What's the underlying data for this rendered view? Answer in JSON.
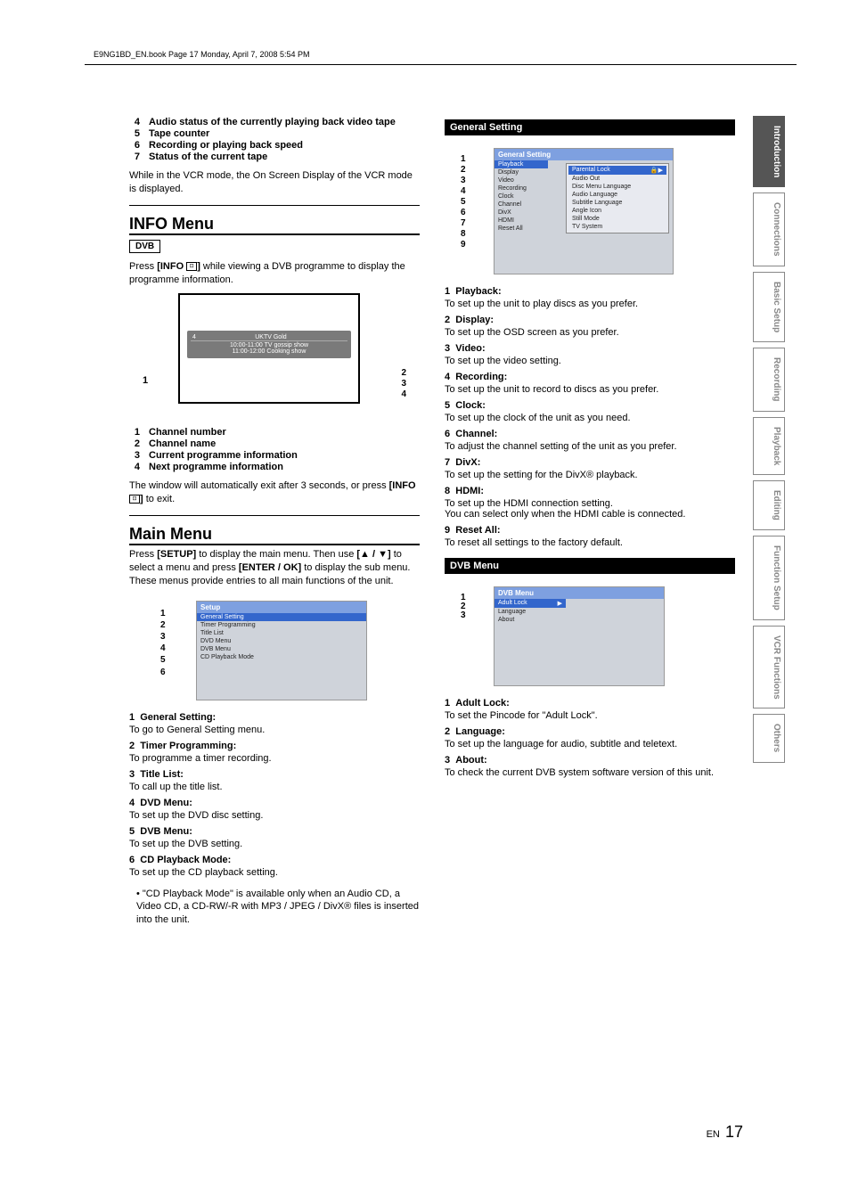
{
  "header": "E9NG1BD_EN.book  Page 17  Monday, April 7, 2008  5:54 PM",
  "side_tabs": [
    "Introduction",
    "Connections",
    "Basic Setup",
    "Recording",
    "Playback",
    "Editing",
    "Function Setup",
    "VCR Functions",
    "Others"
  ],
  "left": {
    "audio_items": [
      {
        "n": "4",
        "t": "Audio status of the currently playing back video tape"
      },
      {
        "n": "5",
        "t": "Tape counter"
      },
      {
        "n": "6",
        "t": "Recording or playing back speed"
      },
      {
        "n": "7",
        "t": "Status of the current tape"
      }
    ],
    "audio_note": "While in the VCR mode, the On Screen Display of the VCR mode is displayed.",
    "info_heading": "INFO Menu",
    "dvb_badge": "DVB",
    "info_text_a": "Press ",
    "info_text_b": "[INFO ",
    "info_text_c": "]",
    "info_text_d": " while viewing a DVB programme to display the programme information.",
    "tv": {
      "ch_num": "4",
      "ch_name": "UKTV Gold",
      "line1": "10:00-11:00 TV gossip show",
      "line2": "11:00-12:00 Cooking show"
    },
    "info_callouts_left": [
      "1"
    ],
    "info_callouts_right": [
      "2",
      "3",
      "4"
    ],
    "info_items": [
      {
        "n": "1",
        "t": "Channel number"
      },
      {
        "n": "2",
        "t": "Channel name"
      },
      {
        "n": "3",
        "t": "Current programme information"
      },
      {
        "n": "4",
        "t": "Next programme information"
      }
    ],
    "info_note_a": "The window will automatically exit after 3 seconds, or press ",
    "info_note_b": "[INFO ",
    "info_note_c": "]",
    "info_note_d": " to exit.",
    "main_heading": "Main Menu",
    "main_text_a": "Press ",
    "main_text_b": "[SETUP]",
    "main_text_c": " to display the main menu. Then use ",
    "main_text_d": "[▲ / ▼]",
    "main_text_e": " to select a menu and press ",
    "main_text_f": "[ENTER / OK]",
    "main_text_g": " to display the sub menu. These menus provide entries to all main functions of the unit.",
    "setup_title": "Setup",
    "setup_items": [
      "General Setting",
      "Timer Programming",
      "Title List",
      "DVD Menu",
      "DVB Menu",
      "CD Playback Mode"
    ],
    "setup_callouts": [
      "1",
      "2",
      "3",
      "4",
      "5",
      "6"
    ],
    "main_defs": [
      {
        "n": "1",
        "t": "General Setting:",
        "d": "To go to General Setting menu."
      },
      {
        "n": "2",
        "t": "Timer Programming:",
        "d": "To programme a timer recording."
      },
      {
        "n": "3",
        "t": "Title List:",
        "d": "To call up the title list."
      },
      {
        "n": "4",
        "t": "DVD Menu:",
        "d": "To set up the DVD disc setting."
      },
      {
        "n": "5",
        "t": "DVB Menu:",
        "d": "To set up the DVB setting."
      },
      {
        "n": "6",
        "t": "CD Playback Mode:",
        "d": "To set up the CD playback setting."
      }
    ],
    "cd_note": "• \"CD Playback Mode\" is available only when an Audio CD, a Video CD, a CD-RW/-R with MP3 / JPEG / DivX® files is inserted into the unit."
  },
  "right": {
    "gs_bar": "General Setting",
    "gs_title": "General Setting",
    "gs_left": [
      "Playback",
      "Display",
      "Video",
      "Recording",
      "Clock",
      "Channel",
      "DivX",
      "HDMI",
      "Reset All"
    ],
    "gs_sub": [
      "Parental Lock",
      "Audio Out",
      "Disc Menu Language",
      "Audio Language",
      "Subtitle Language",
      "Angle Icon",
      "Still Mode",
      "TV System"
    ],
    "gs_callouts": [
      "1",
      "2",
      "3",
      "4",
      "5",
      "6",
      "7",
      "8",
      "9"
    ],
    "gs_defs": [
      {
        "n": "1",
        "t": "Playback:",
        "d": "To set up the unit to play discs as you prefer."
      },
      {
        "n": "2",
        "t": "Display:",
        "d": "To set up the OSD screen as you prefer."
      },
      {
        "n": "3",
        "t": "Video:",
        "d": "To set up the video setting."
      },
      {
        "n": "4",
        "t": "Recording:",
        "d": "To set up the unit to record to discs as you prefer."
      },
      {
        "n": "5",
        "t": "Clock:",
        "d": "To set up the clock of the unit as you need."
      },
      {
        "n": "6",
        "t": "Channel:",
        "d": "To adjust the channel setting of the unit as you prefer."
      },
      {
        "n": "7",
        "t": "DivX:",
        "d": "To set up the setting for the DivX® playback."
      },
      {
        "n": "8",
        "t": "HDMI:",
        "d": "To set up the HDMI connection setting.\nYou can select only when the HDMI cable is connected."
      },
      {
        "n": "9",
        "t": "Reset All:",
        "d": "To reset all settings to the factory default."
      }
    ],
    "dvb_bar": "DVB Menu",
    "dvb_title": "DVB Menu",
    "dvb_items": [
      "Adult Lock",
      "Language",
      "About"
    ],
    "dvb_callouts": [
      "1",
      "2",
      "3"
    ],
    "dvb_defs": [
      {
        "n": "1",
        "t": "Adult Lock:",
        "d": "To set the Pincode for \"Adult Lock\"."
      },
      {
        "n": "2",
        "t": "Language:",
        "d": "To set up the language for audio, subtitle and teletext."
      },
      {
        "n": "3",
        "t": "About:",
        "d": "To check the current DVB system software version of this unit."
      }
    ]
  },
  "footer": {
    "en": "EN",
    "page": "17"
  }
}
